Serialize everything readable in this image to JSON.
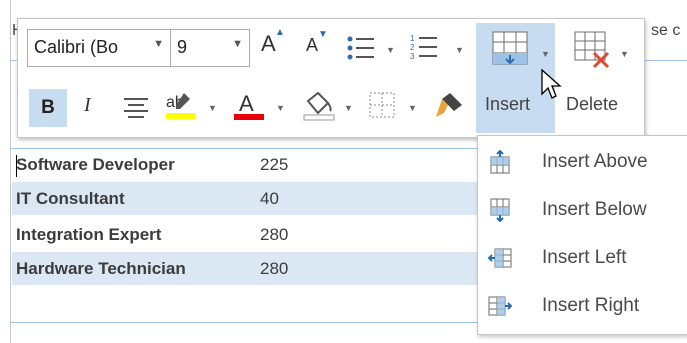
{
  "document": {
    "text_peek_left": "H",
    "text_peek_right": "se c",
    "table": [
      {
        "name": "Software Developer",
        "value": "225"
      },
      {
        "name": "IT Consultant",
        "value": "40"
      },
      {
        "name": "Integration Expert",
        "value": "280"
      },
      {
        "name": "Hardware Technician",
        "value": "280"
      }
    ]
  },
  "toolbar": {
    "font_name": "Calibri (Bo",
    "font_size": "9",
    "bold_label": "B",
    "italic_label": "I",
    "insert_label": "Insert",
    "delete_label": "Delete",
    "highlight_color": "#ffff00",
    "font_color": "#e8000b"
  },
  "insert_menu": {
    "items": [
      {
        "label": "Insert Above",
        "icon": "insert-above-icon"
      },
      {
        "label": "Insert Below",
        "icon": "insert-below-icon"
      },
      {
        "label": "Insert Left",
        "icon": "insert-left-icon"
      },
      {
        "label": "Insert Right",
        "icon": "insert-right-icon"
      }
    ]
  }
}
